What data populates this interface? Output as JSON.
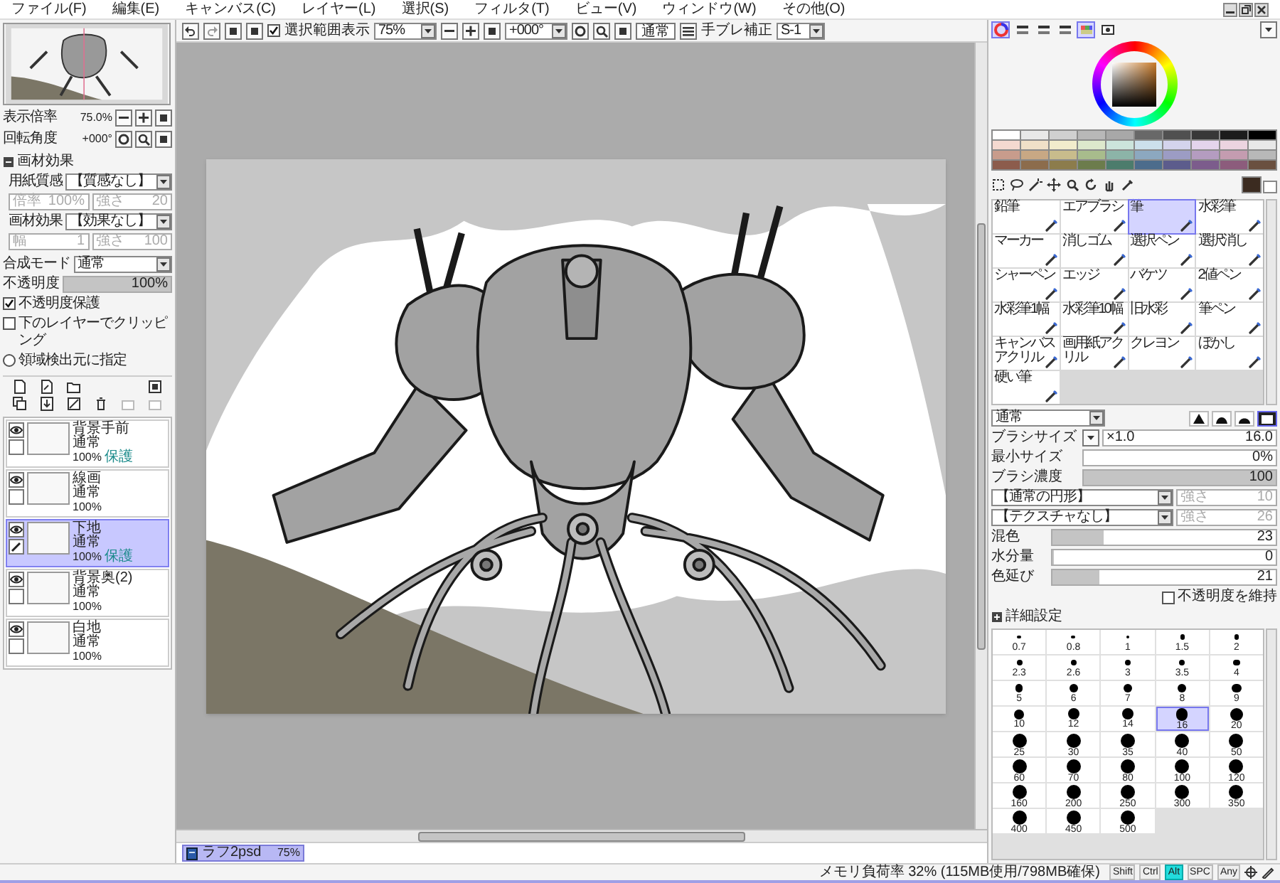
{
  "menu": [
    {
      "label": "ファイル(F)"
    },
    {
      "label": "編集(E)"
    },
    {
      "label": "キャンバス(C)"
    },
    {
      "label": "レイヤー(L)"
    },
    {
      "label": "選択(S)"
    },
    {
      "label": "フィルタ(T)"
    },
    {
      "label": "ビュー(V)"
    },
    {
      "label": "ウィンドウ(W)"
    },
    {
      "label": "その他(O)"
    }
  ],
  "toolbar": {
    "selection_display": {
      "label": "選択範囲表示",
      "checked": true
    },
    "zoom": "75%",
    "rotation": "+000°",
    "blend": "通常",
    "stabilizer": {
      "label": "手ブレ補正",
      "value": "S-1"
    }
  },
  "navigator": {
    "zoom": {
      "label": "表示倍率",
      "value": "75.0%"
    },
    "rotation": {
      "label": "回転角度",
      "value": "+000°"
    }
  },
  "material_effect": {
    "title": "画材効果",
    "rows": [
      {
        "label": "用紙質感",
        "value": "【質感なし】",
        "params": [
          {
            "label": "倍率",
            "value": "100%",
            "disabled": true
          },
          {
            "label": "強さ",
            "value": "20",
            "disabled": true
          }
        ]
      },
      {
        "label": "画材効果",
        "value": "【効果なし】",
        "params": [
          {
            "label": "幅",
            "value": "1",
            "disabled": true
          },
          {
            "label": "強さ",
            "value": "100",
            "disabled": true
          }
        ]
      }
    ]
  },
  "blend_mode": {
    "label": "合成モード",
    "value": "通常"
  },
  "opacity": {
    "label": "不透明度",
    "value": "100%",
    "level": 1
  },
  "layer_options": [
    {
      "kind": "checkbox",
      "label": "不透明度保護",
      "checked": true
    },
    {
      "kind": "checkbox",
      "label": "下のレイヤーでクリッピング",
      "checked": false
    },
    {
      "kind": "radio",
      "label": "領域検出元に指定",
      "checked": false
    }
  ],
  "layers": [
    {
      "name": "背景手前",
      "mode": "通常",
      "opacity": "100%",
      "protect": "保護",
      "visible": true,
      "selected": false
    },
    {
      "name": "線画",
      "mode": "通常",
      "opacity": "100%",
      "visible": true,
      "selected": false
    },
    {
      "name": "下地",
      "mode": "通常",
      "opacity": "100%",
      "protect": "保護",
      "visible": true,
      "selected": true
    },
    {
      "name": "背景奥(2)",
      "mode": "通常",
      "opacity": "100%",
      "visible": true,
      "selected": false
    },
    {
      "name": "白地",
      "mode": "通常",
      "opacity": "100%",
      "visible": true,
      "selected": false
    }
  ],
  "document_tabs": [
    {
      "name": "ラフ2psd",
      "zoom": "75%",
      "selected": true
    }
  ],
  "color_panel_toggles": [
    {
      "kind": "wheel",
      "selected": true
    },
    {
      "kind": "slider",
      "selected": false
    },
    {
      "kind": "slider",
      "selected": false
    },
    {
      "kind": "slider",
      "selected": false
    },
    {
      "kind": "swatches",
      "selected": true
    },
    {
      "kind": "scratchpad",
      "selected": false
    }
  ],
  "current_color": {
    "color": "#3b2b20"
  },
  "palette": [
    {
      "color": "#ffffff"
    },
    {
      "color": "#e8e8e8"
    },
    {
      "color": "#d0d0d0"
    },
    {
      "color": "#b8b8b8"
    },
    {
      "color": "#a8a8a8"
    },
    {
      "color": "#686868"
    },
    {
      "color": "#505050"
    },
    {
      "color": "#383838"
    },
    {
      "color": "#1c1c1c"
    },
    {
      "color": "#000000"
    },
    {
      "color": "#f4d9d0"
    },
    {
      "color": "#f0e0c8"
    },
    {
      "color": "#f2eccc"
    },
    {
      "color": "#dde8cc"
    },
    {
      "color": "#cce4dc"
    },
    {
      "color": "#cce0ec"
    },
    {
      "color": "#d4d4ec"
    },
    {
      "color": "#e4d4ec"
    },
    {
      "color": "#ecd4e0"
    },
    {
      "color": "#e8e8e8"
    },
    {
      "color": "#c89c8c"
    },
    {
      "color": "#c8a884"
    },
    {
      "color": "#c8bc8c"
    },
    {
      "color": "#a8bc8c"
    },
    {
      "color": "#8cb4a8"
    },
    {
      "color": "#8ca8c0"
    },
    {
      "color": "#9c9cc4"
    },
    {
      "color": "#b49cc0"
    },
    {
      "color": "#c49cb0"
    },
    {
      "color": "#b8b8b8"
    },
    {
      "color": "#8c5c4c"
    },
    {
      "color": "#8c6c4c"
    },
    {
      "color": "#8c7c4c"
    },
    {
      "color": "#6c7c4c"
    },
    {
      "color": "#4c7c6c"
    },
    {
      "color": "#4c6c8c"
    },
    {
      "color": "#5c5c8c"
    },
    {
      "color": "#7c5c8c"
    },
    {
      "color": "#8c5c7c"
    },
    {
      "color": "#6a5040"
    }
  ],
  "brush_tools": [
    {
      "label": "鉛筆",
      "selected": false
    },
    {
      "label": "エアブラシ",
      "selected": false
    },
    {
      "label": "筆",
      "selected": true
    },
    {
      "label": "水彩筆",
      "selected": false
    },
    {
      "label": "マーカー",
      "selected": false
    },
    {
      "label": "消しゴム",
      "selected": false
    },
    {
      "label": "選択ペン",
      "selected": false
    },
    {
      "label": "選択消し",
      "selected": false
    },
    {
      "label": "シャーペン",
      "selected": false
    },
    {
      "label": "エッジ",
      "selected": false
    },
    {
      "label": "バケツ",
      "selected": false
    },
    {
      "label": "2値ペン",
      "selected": false
    },
    {
      "label": "水彩筆1幅",
      "selected": false
    },
    {
      "label": "水彩筆10幅",
      "selected": false
    },
    {
      "label": "旧水彩",
      "selected": false
    },
    {
      "label": "筆ペン",
      "selected": false
    },
    {
      "label": "キャンバスアクリル",
      "selected": false
    },
    {
      "label": "画用紙アクリル",
      "selected": false
    },
    {
      "label": "クレヨン",
      "selected": false
    },
    {
      "label": "ぼかし",
      "selected": false
    },
    {
      "label": "硬い筆",
      "selected": false
    }
  ],
  "brush": {
    "mode": "通常",
    "shapes": [
      {
        "selected": false
      },
      {
        "selected": false
      },
      {
        "selected": false
      },
      {
        "selected": true
      }
    ],
    "size": {
      "label": "ブラシサイズ",
      "multiplier": "×1.0",
      "value": "16.0"
    },
    "min_size": {
      "label": "最小サイズ",
      "value": "0%"
    },
    "density": {
      "label": "ブラシ濃度",
      "value": "100",
      "level": 1
    },
    "shape": {
      "value": "【通常の円形】",
      "param": {
        "label": "強さ",
        "value": "10",
        "disabled": true
      }
    },
    "texture": {
      "value": "【テクスチャなし】",
      "param": {
        "label": "強さ",
        "value": "26",
        "disabled": true
      }
    },
    "mix": [
      {
        "label": "混色",
        "value": "23",
        "level": 0.23
      },
      {
        "label": "水分量",
        "value": "0",
        "level": 0
      },
      {
        "label": "色延び",
        "value": "21",
        "level": 0.21
      }
    ],
    "keep_opacity": {
      "label": "不透明度を維持",
      "checked": false
    },
    "details_title": "詳細設定"
  },
  "brush_sizes": [
    {
      "label": "0.7",
      "selected": false
    },
    {
      "label": "0.8",
      "selected": false
    },
    {
      "label": "1",
      "selected": false
    },
    {
      "label": "1.5",
      "selected": false
    },
    {
      "label": "2",
      "selected": false
    },
    {
      "label": "2.3",
      "selected": false
    },
    {
      "label": "2.6",
      "selected": false
    },
    {
      "label": "3",
      "selected": false
    },
    {
      "label": "3.5",
      "selected": false
    },
    {
      "label": "4",
      "selected": false
    },
    {
      "label": "5",
      "selected": false
    },
    {
      "label": "6",
      "selected": false
    },
    {
      "label": "7",
      "selected": false
    },
    {
      "label": "8",
      "selected": false
    },
    {
      "label": "9",
      "selected": false
    },
    {
      "label": "10",
      "selected": false
    },
    {
      "label": "12",
      "selected": false
    },
    {
      "label": "14",
      "selected": false
    },
    {
      "label": "16",
      "selected": true
    },
    {
      "label": "20",
      "selected": false
    },
    {
      "label": "25",
      "selected": false
    },
    {
      "label": "30",
      "selected": false
    },
    {
      "label": "35",
      "selected": false
    },
    {
      "label": "40",
      "selected": false
    },
    {
      "label": "50",
      "selected": false
    },
    {
      "label": "60",
      "selected": false
    },
    {
      "label": "70",
      "selected": false
    },
    {
      "label": "80",
      "selected": false
    },
    {
      "label": "100",
      "selected": false
    },
    {
      "label": "120",
      "selected": false
    },
    {
      "label": "160",
      "selected": false
    },
    {
      "label": "200",
      "selected": false
    },
    {
      "label": "250",
      "selected": false
    },
    {
      "label": "300",
      "selected": false
    },
    {
      "label": "350",
      "selected": false
    },
    {
      "label": "400",
      "selected": false
    },
    {
      "label": "450",
      "selected": false
    },
    {
      "label": "500",
      "selected": false
    }
  ],
  "status_bar": {
    "memory": "メモリ負荷率 32% (115MB使用/798MB確保)",
    "keys": [
      {
        "label": "Shift",
        "on": false
      },
      {
        "label": "Ctrl",
        "on": false
      },
      {
        "label": "Alt",
        "on": true
      },
      {
        "label": "SPC",
        "on": false
      },
      {
        "label": "Any",
        "on": false
      }
    ]
  }
}
